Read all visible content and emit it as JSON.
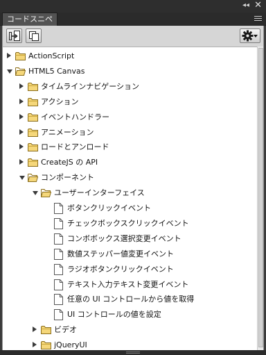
{
  "window": {
    "collapse_glyph": "◂◂",
    "close_glyph": "✕"
  },
  "tab": {
    "label": "コードスニペット"
  },
  "icons": {
    "add_to_frame": "add-to-frame-icon",
    "copy": "copy-to-clipboard-icon",
    "options": "gear-icon"
  },
  "tree": [
    {
      "label": "ActionScript",
      "kind": "folder",
      "level": 0,
      "state": "collapsed"
    },
    {
      "label": "HTML5 Canvas",
      "kind": "folder",
      "level": 0,
      "state": "expanded"
    },
    {
      "label": "タイムラインナビゲーション",
      "kind": "folder",
      "level": 1,
      "state": "collapsed"
    },
    {
      "label": "アクション",
      "kind": "folder",
      "level": 1,
      "state": "collapsed"
    },
    {
      "label": "イベントハンドラー",
      "kind": "folder",
      "level": 1,
      "state": "collapsed"
    },
    {
      "label": "アニメーション",
      "kind": "folder",
      "level": 1,
      "state": "collapsed"
    },
    {
      "label": "ロードとアンロード",
      "kind": "folder",
      "level": 1,
      "state": "collapsed"
    },
    {
      "label": "CreateJS の API",
      "kind": "folder",
      "level": 1,
      "state": "collapsed"
    },
    {
      "label": "コンポーネント",
      "kind": "folder",
      "level": 1,
      "state": "expanded"
    },
    {
      "label": "ユーザーインターフェイス",
      "kind": "folder",
      "level": 2,
      "state": "expanded"
    },
    {
      "label": "ボタンクリックイベント",
      "kind": "file",
      "level": 3
    },
    {
      "label": "チェックボックスクリックイベント",
      "kind": "file",
      "level": 3
    },
    {
      "label": "コンボボックス選択変更イベント",
      "kind": "file",
      "level": 3
    },
    {
      "label": "数値ステッパー値変更イベント",
      "kind": "file",
      "level": 3
    },
    {
      "label": "ラジオボタンクリックイベント",
      "kind": "file",
      "level": 3
    },
    {
      "label": "テキスト入力テキスト変更イベント",
      "kind": "file",
      "level": 3
    },
    {
      "label": "任意の UI コントロールから値を取得",
      "kind": "file",
      "level": 3
    },
    {
      "label": "UI コントロールの値を設定",
      "kind": "file",
      "level": 3
    },
    {
      "label": "ビデオ",
      "kind": "folder",
      "level": 2,
      "state": "collapsed"
    },
    {
      "label": "jQueryUI",
      "kind": "folder",
      "level": 2,
      "state": "collapsed"
    }
  ]
}
